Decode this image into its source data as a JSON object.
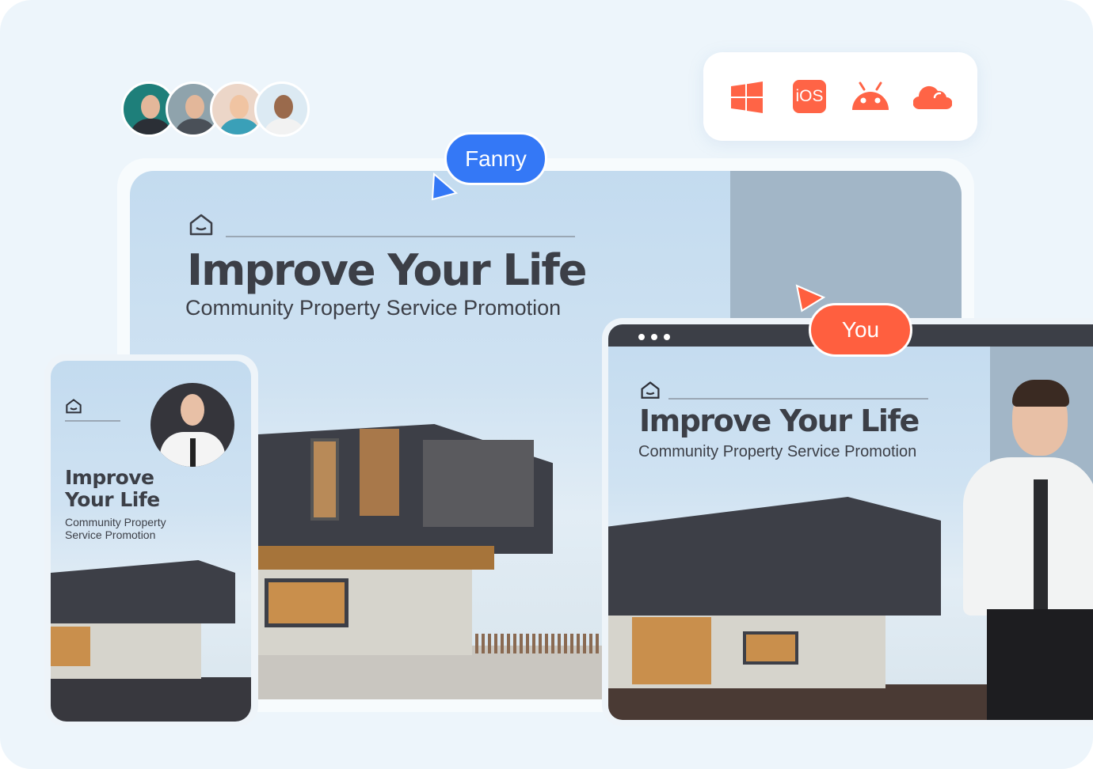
{
  "avatars": [
    {
      "name": "avatar-1",
      "bg": "#1e7f7a"
    },
    {
      "name": "avatar-2",
      "bg": "#8aa0a8"
    },
    {
      "name": "avatar-3",
      "bg": "#e9d2c4"
    },
    {
      "name": "avatar-4",
      "bg": "#d8e8f2"
    }
  ],
  "platforms": {
    "items": [
      "windows-icon",
      "ios-icon",
      "android-icon",
      "cloud-icon"
    ],
    "ios_label": "iOS",
    "color": "#ff6446"
  },
  "collaborators": {
    "fanny": {
      "label": "Fanny",
      "color": "#3478f6"
    },
    "you": {
      "label": "You",
      "color": "#ff5f3f"
    }
  },
  "desktop": {
    "title": "Improve Your Life",
    "subtitle": "Community Property Service Promotion"
  },
  "phone": {
    "title_line1": "Improve",
    "title_line2": "Your Life",
    "subtitle_line1": "Community Property",
    "subtitle_line2": "Service Promotion"
  },
  "tablet": {
    "title": "Improve Your Life",
    "subtitle": "Community Property Service Promotion"
  }
}
